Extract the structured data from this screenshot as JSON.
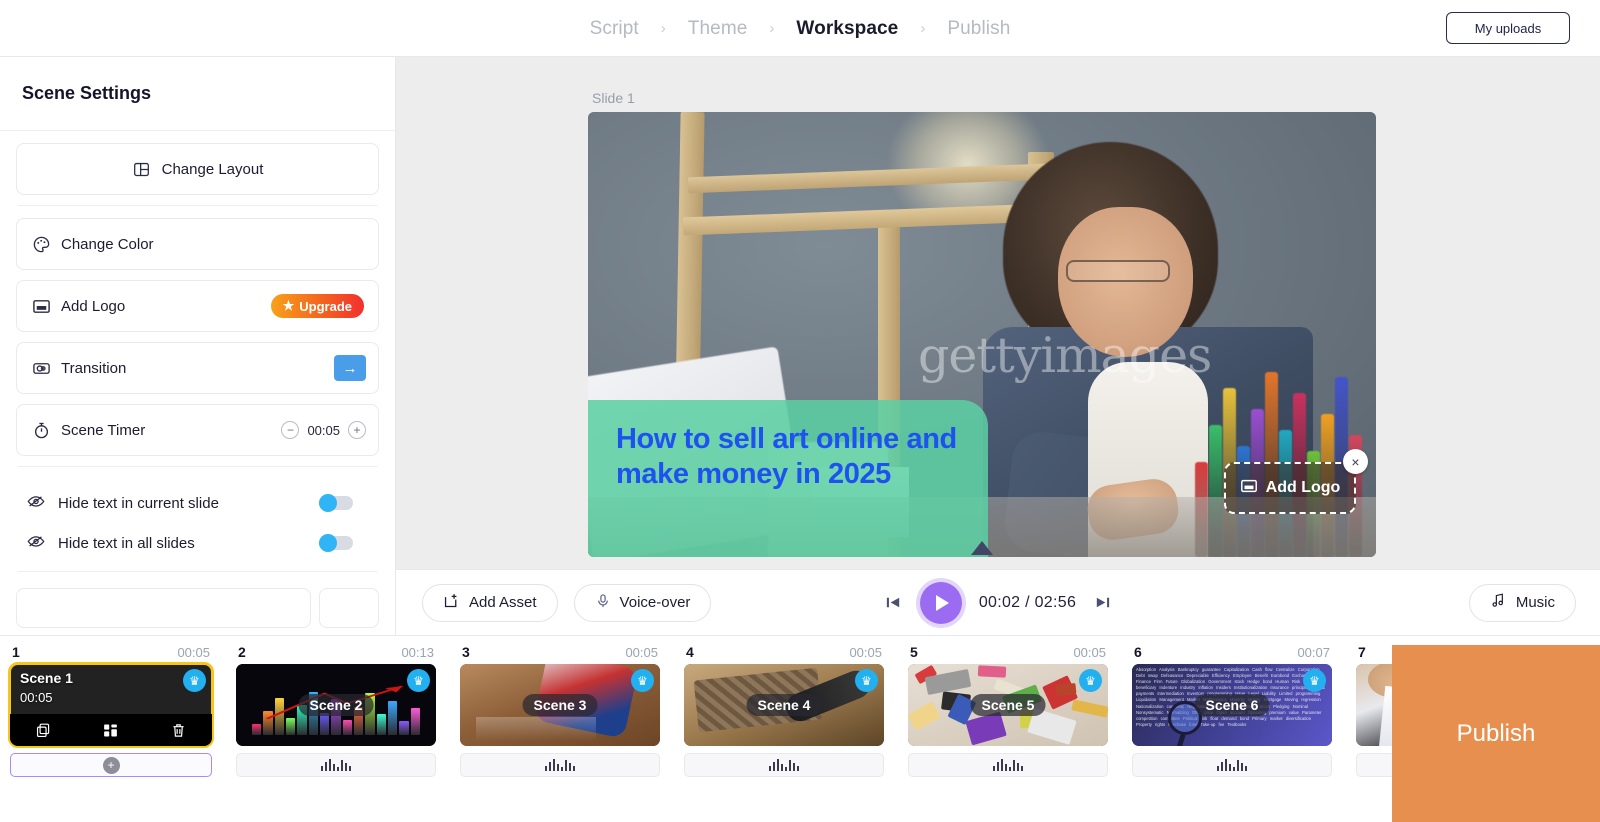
{
  "header": {
    "breadcrumb": [
      {
        "label": "Script",
        "active": false
      },
      {
        "label": "Theme",
        "active": false
      },
      {
        "label": "Workspace",
        "active": true
      },
      {
        "label": "Publish",
        "active": false
      }
    ],
    "separator": "›",
    "my_uploads_label": "My uploads"
  },
  "sidebar": {
    "title": "Scene Settings",
    "change_layout": {
      "label": "Change Layout",
      "icon": "layout-icon"
    },
    "change_color": {
      "label": "Change Color",
      "icon": "palette-icon"
    },
    "add_logo": {
      "label": "Add Logo",
      "icon": "image-icon",
      "badge": "Upgrade",
      "badge_star": "★"
    },
    "transition": {
      "label": "Transition",
      "icon": "transition-icon",
      "button_icon": "→"
    },
    "scene_timer": {
      "label": "Scene Timer",
      "icon": "stopwatch-icon",
      "value": "00:05",
      "decrement": "−",
      "increment": "+"
    },
    "toggles": [
      {
        "label": "Hide text in current slide",
        "icon": "eye-off-icon",
        "on": true
      },
      {
        "label": "Hide text in all slides",
        "icon": "eye-off-icon",
        "on": true
      }
    ]
  },
  "stage": {
    "slide_label": "Slide 1",
    "caption": "How to sell art online and make money in 2025",
    "watermark": "gettyimages",
    "caption_color": "#1e52f0",
    "caption_bg": "#5bcfa3",
    "logo_overlay": {
      "label": "Add Logo",
      "icon": "image-icon",
      "close_icon": "×"
    }
  },
  "playbar": {
    "add_asset": {
      "label": "Add Asset",
      "icon": "add-asset-icon"
    },
    "voice_over": {
      "label": "Voice-over",
      "icon": "microphone-icon"
    },
    "prev_icon": "skip-previous-icon",
    "play_icon": "play-icon",
    "next_icon": "skip-next-icon",
    "time": "00:02 / 02:56",
    "music": {
      "label": "Music",
      "icon": "music-note-icon"
    }
  },
  "timeline": {
    "scenes": [
      {
        "number": "1",
        "duration": "00:05",
        "title": "Scene 1",
        "overlay_time": "00:05",
        "selected": true,
        "premium": true,
        "audio": "add",
        "tools": [
          {
            "name": "duplicate-icon"
          },
          {
            "name": "layout-icon"
          },
          {
            "name": "delete-icon"
          }
        ]
      },
      {
        "number": "2",
        "duration": "00:13",
        "title": "Scene 2",
        "selected": false,
        "premium": true,
        "audio": "wave"
      },
      {
        "number": "3",
        "duration": "00:05",
        "title": "Scene 3",
        "selected": false,
        "premium": true,
        "audio": "wave"
      },
      {
        "number": "4",
        "duration": "00:05",
        "title": "Scene 4",
        "selected": false,
        "premium": true,
        "audio": "wave"
      },
      {
        "number": "5",
        "duration": "00:05",
        "title": "Scene 5",
        "selected": false,
        "premium": true,
        "audio": "wave"
      },
      {
        "number": "6",
        "duration": "00:07",
        "title": "Scene 6",
        "selected": false,
        "premium": true,
        "audio": "wave"
      },
      {
        "number": "7",
        "duration": "",
        "title": "",
        "selected": false,
        "premium": false,
        "audio": "wave"
      }
    ],
    "add_scene_icon": "+",
    "crown_icon": "♛",
    "publish_label": "Publish",
    "publish_color": "#e78f4e"
  },
  "scene6_text": "Absorption Analysis Bankruptcy guarantee Capitalization Cash flow Centralize Corporation Debt swap Defeasance Depreciable Efficiency Employee Benefit Eurobond Exchange Finance Firm Future Globalization Government stock Hedge bond Human Risk strategy beneficiary Indenture Industry Inflation Insiders Institutionalization Insurance principle Interest payments Intermediation Inventory programming Issue Legal Liability Limited programming Liquidation Management Market Mathematics Maturity Money Mortgage Moving regression Nationalization convexity Negotiated benefit Net investment Stock Pledging Nominal Nonsystematic Normalizing Offer price Open account Operating premium value Parameter competition committee Political risk float demand bond Primary market diversification Property rights Purchase fund Take-up fee Textbooks"
}
